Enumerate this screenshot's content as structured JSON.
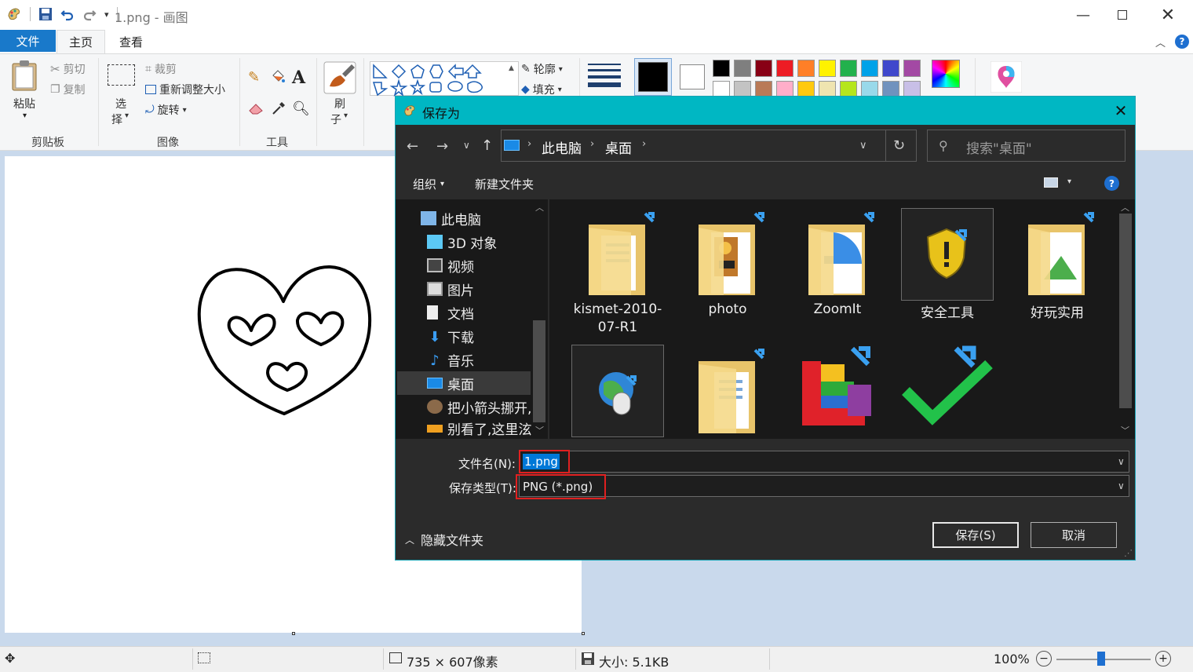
{
  "app": {
    "title": "1.png - 画图"
  },
  "tabs": {
    "file": "文件",
    "home": "主页",
    "view": "查看"
  },
  "ribbon": {
    "paste": "粘贴",
    "cut": "剪切",
    "copy": "复制",
    "clipboard_group": "剪贴板",
    "select_1": "选",
    "select_2": "择",
    "crop": "裁剪",
    "resize": "重新调整大小",
    "rotate": "旋转",
    "image_group": "图像",
    "tools_group": "工具",
    "text_tool": "A",
    "brush_1": "刷",
    "brush_2": "子",
    "outline": "轮廓",
    "fill": "填充"
  },
  "palette": {
    "row1": [
      "#000000",
      "#7f7f7f",
      "#880015",
      "#ed1c24",
      "#ff7f27",
      "#fff200",
      "#22b14c",
      "#00a2e8",
      "#3f48cc",
      "#a349a4"
    ],
    "row2": [
      "#ffffff",
      "#c3c3c3",
      "#b97a57",
      "#ffaec9",
      "#ffc90e",
      "#efe4b0",
      "#b5e61d",
      "#99d9ea",
      "#7092be",
      "#c8bfe7"
    ]
  },
  "statusbar": {
    "dimensions": "735 × 607像素",
    "size": "大小: 5.1KB",
    "zoom": "100%"
  },
  "dialog": {
    "title": "保存为",
    "breadcrumb": {
      "pc": "此电脑",
      "desktop": "桌面"
    },
    "search_placeholder": "搜索\"桌面\"",
    "organize": "组织",
    "new_folder": "新建文件夹",
    "nav_items": [
      {
        "label": "此电脑"
      },
      {
        "label": "3D 对象"
      },
      {
        "label": "视频"
      },
      {
        "label": "图片"
      },
      {
        "label": "文档"
      },
      {
        "label": "下载"
      },
      {
        "label": "音乐"
      },
      {
        "label": "桌面"
      },
      {
        "label": "把小箭头挪开,"
      },
      {
        "label": "别看了,这里泫"
      }
    ],
    "files": [
      {
        "name_1": "kismet-2010-",
        "name_2": "07-R1"
      },
      {
        "name_1": "photo"
      },
      {
        "name_1": "ZoomIt"
      },
      {
        "name_1": "安全工具"
      },
      {
        "name_1": "好玩实用"
      }
    ],
    "filename_label": "文件名(N):",
    "filename_value": "1.png",
    "filetype_label": "保存类型(T):",
    "filetype_value": "PNG (*.png)",
    "hide_folders": "隐藏文件夹",
    "save": "保存(S)",
    "cancel": "取消"
  }
}
